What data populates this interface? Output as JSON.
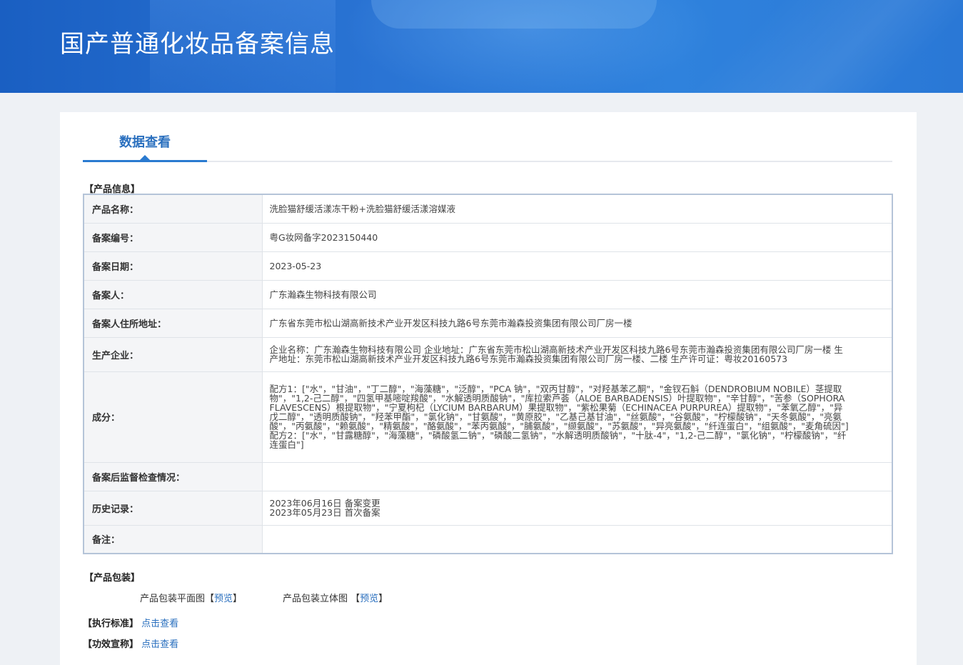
{
  "header": {
    "title": "国产普通化妆品备案信息"
  },
  "tabs": {
    "active_label": "数据查看"
  },
  "product_section": {
    "label": "【产品信息】"
  },
  "rows": [
    {
      "key": "产品名称：",
      "value": "洗脸猫舒缓活漾冻干粉+洗脸猫舒缓活漾溶媒液"
    },
    {
      "key": "备案编号：",
      "value": "粤G妆网备字2023150440"
    },
    {
      "key": "备案日期：",
      "value": "2023-05-23"
    },
    {
      "key": "备案人：",
      "value": "广东瀚森生物科技有限公司"
    },
    {
      "key": "备案人住所地址：",
      "value": "广东省东莞市松山湖高新技术产业开发区科技九路6号东莞市瀚森投资集团有限公司厂房一楼"
    },
    {
      "key": "生产企业：",
      "value": "企业名称：广东瀚森生物科技有限公司 企业地址：广东省东莞市松山湖高新技术产业开发区科技九路6号东莞市瀚森投资集团有限公司厂房一楼 生产地址：东莞市松山湖高新技术产业开发区科技九路6号东莞市瀚森投资集团有限公司厂房一楼、二楼 生产许可证：粤妆20160573"
    },
    {
      "key": "成分：",
      "value": "配方1：[\"水\"，\"甘油\"，\"丁二醇\"，\"海藻糖\"，\"泛醇\"，\"PCA 钠\"，\"双丙甘醇\"，\"对羟基苯乙酮\"，\"金钗石斛（DENDROBIUM NOBILE）茎提取物\"，\"1,2-己二醇\"，\"四氢甲基嘧啶羧酸\"，\"水解透明质酸钠\"，\"库拉索芦荟（ALOE BARBADENSIS）叶提取物\"，\"辛甘醇\"，\"苦参（SOPHORA FLAVESCENS）根提取物\"，\"宁夏枸杞（LYCIUM BARBARUM）果提取物\"，\"紫松果菊（ECHINACEA PURPUREA）提取物\"，\"苯氧乙醇\"，\"异戊二醇\"，\"透明质酸钠\"，\"羟苯甲酯\"，\"氯化钠\"，\"甘氨酸\"，\"黄原胶\"，\"乙基己基甘油\"，\"丝氨酸\"，\"谷氨酸\"，\"柠檬酸钠\"，\"天冬氨酸\"，\"亮氨酸\"，\"丙氨酸\"，\"赖氨酸\"，\"精氨酸\"，\"酪氨酸\"，\"苯丙氨酸\"，\"脯氨酸\"，\"缬氨酸\"，\"苏氨酸\"，\"异亮氨酸\"，\"纤连蛋白\"，\"组氨酸\"，\"麦角硫因\"]\n配方2：[\"水\"，\"甘露糖醇\"，\"海藻糖\"，\"磷酸氢二钠\"，\"磷酸二氢钠\"，\"水解透明质酸钠\"，\"十肽-4\"，\"1,2-己二醇\"，\"氯化钠\"，\"柠檬酸钠\"，\"纤连蛋白\"]"
    },
    {
      "key": "备案后监督检查情况：",
      "value": ""
    },
    {
      "key": "历史记录：",
      "value": "2023年06月16日 备案变更\n2023年05月23日 首次备案"
    },
    {
      "key": "备注：",
      "value": ""
    }
  ],
  "packaging": {
    "label": "【产品包装】",
    "flat_label": "产品包装平面图【",
    "flat_link": "预览",
    "flat_close": "】",
    "solid_label": "产品包装立体图 【",
    "solid_link": "预览",
    "solid_close": "】"
  },
  "standard": {
    "label": "【执行标准】",
    "link": "点击查看"
  },
  "efficacy": {
    "label": "【功效宣称】",
    "link": "点击查看"
  }
}
